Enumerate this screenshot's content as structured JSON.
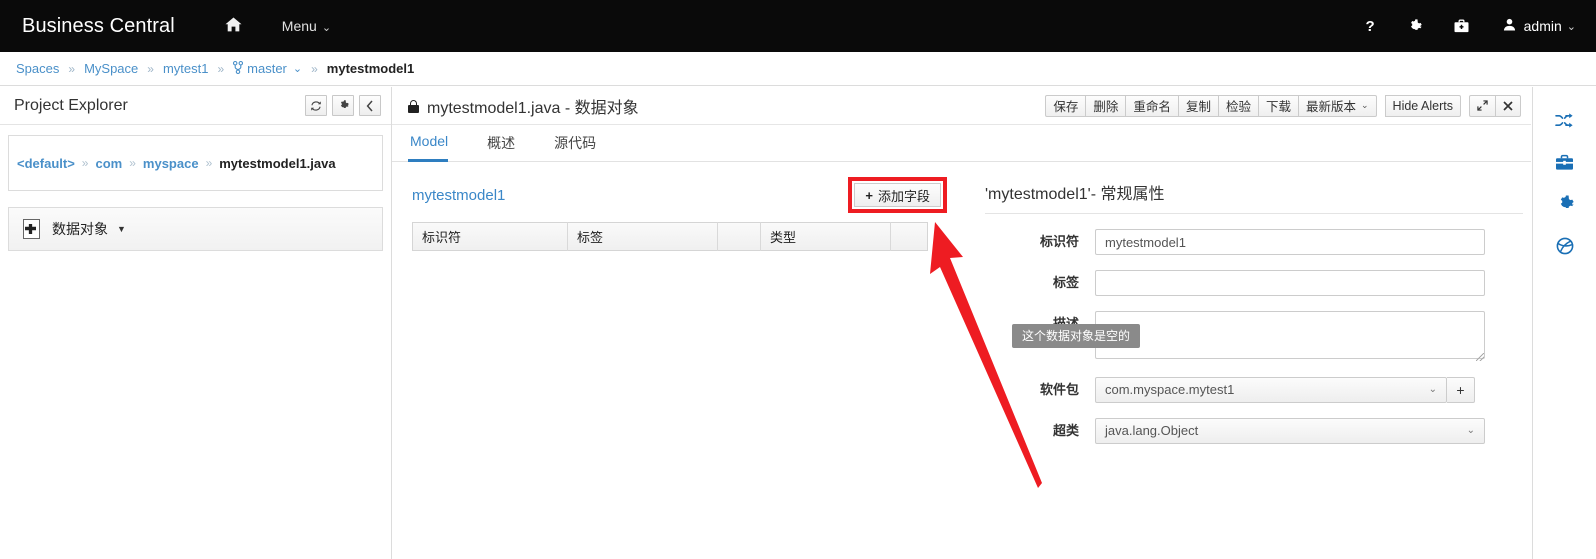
{
  "navbar": {
    "brand": "Business Central",
    "home_icon": "home-icon",
    "menu_label": "Menu",
    "menu_caret": "⌄",
    "help_icon": "?",
    "gear_icon": "⚙",
    "briefcase_icon": "ὋC",
    "user_icon": "👤",
    "user_label": "admin",
    "user_caret": "⌄"
  },
  "breadcrumb": {
    "separator": "»",
    "branch_glyph": "⎇",
    "items": [
      {
        "label": "Spaces",
        "link": true
      },
      {
        "label": "MySpace",
        "link": true
      },
      {
        "label": "mytest1",
        "link": true
      },
      {
        "label": "master",
        "link": true,
        "branch": true,
        "caret": "⌄"
      },
      {
        "label": "mytestmodel1",
        "link": false
      }
    ]
  },
  "left_panel": {
    "title": "Project Explorer",
    "buttons": [
      {
        "name": "refresh",
        "glyph": "↻"
      },
      {
        "name": "settings",
        "glyph": "⚙"
      },
      {
        "name": "collapse",
        "glyph": "‹"
      }
    ],
    "path": {
      "separator": "»",
      "items": [
        {
          "label": "<default>",
          "link": true
        },
        {
          "label": "com",
          "link": true
        },
        {
          "label": "myspace",
          "link": true
        },
        {
          "label": "mytestmodel1.java",
          "link": false
        }
      ]
    },
    "asset": {
      "icon": "data-object-icon",
      "label": "数据对象",
      "caret": "▼"
    }
  },
  "main": {
    "lock_icon": "lock-icon",
    "doc_title": "mytestmodel1.java - 数据对象",
    "toolbar": {
      "group1": [
        "保存",
        "删除",
        "重命名",
        "复制",
        "检验",
        "下载"
      ],
      "version_label": "最新版本",
      "version_caret": "⌄",
      "hide_alerts": "Hide Alerts",
      "maximize_glyph": "⤢",
      "close_glyph": "✕"
    },
    "tabs": [
      {
        "label": "Model",
        "active": true
      },
      {
        "label": "概述",
        "active": false
      },
      {
        "label": "源代码",
        "active": false
      }
    ],
    "editor": {
      "model_name": "mytestmodel1",
      "add_field_label": "添加字段",
      "add_field_plus": "+",
      "table_headers": [
        "标识符",
        "标签",
        "",
        "类型",
        ""
      ],
      "empty_tooltip": "这个数据对象是空的"
    },
    "properties": {
      "title": "'mytestmodel1'- 常规属性",
      "fields": [
        {
          "label": "标识符",
          "value": "mytestmodel1",
          "type": "text"
        },
        {
          "label": "标签",
          "value": "",
          "type": "text"
        },
        {
          "label": "描述",
          "value": "",
          "type": "textarea"
        },
        {
          "label": "软件包",
          "value": "com.myspace.mytest1",
          "type": "select-add",
          "caret": "⌄",
          "add_glyph": "+"
        },
        {
          "label": "超类",
          "value": "java.lang.Object",
          "type": "select",
          "caret": "⌄"
        }
      ]
    }
  },
  "rail": {
    "icons": [
      {
        "name": "shuffle-icon",
        "glyph": "⤨"
      },
      {
        "name": "briefcase-icon",
        "glyph": "☒"
      },
      {
        "name": "gear-icon",
        "glyph": "⚙"
      },
      {
        "name": "globe-icon",
        "glyph": "◎"
      }
    ]
  },
  "annotation": {
    "color": "#ee1c22",
    "target": "add-field-button"
  }
}
